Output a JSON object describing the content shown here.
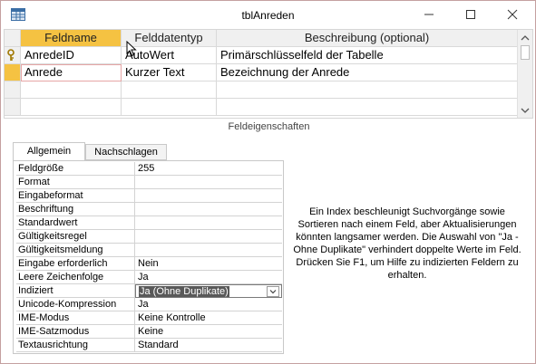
{
  "window": {
    "title": "tblAnreden"
  },
  "colors": {
    "selected_header": "#f5c242",
    "focused_value_bg": "#595959"
  },
  "grid": {
    "headers": [
      "Feldname",
      "Felddatentyp",
      "Beschreibung (optional)"
    ],
    "rows": [
      {
        "feldname": "AnredeID",
        "datentyp": "AutoWert",
        "beschreibung": "Primärschlüsselfeld der Tabelle",
        "primary_key": true
      },
      {
        "feldname": "Anrede",
        "datentyp": "Kurzer Text",
        "beschreibung": "Bezeichnung der Anrede",
        "primary_key": false
      }
    ]
  },
  "section_label": "Feldeigenschaften",
  "tabs": [
    "Allgemein",
    "Nachschlagen"
  ],
  "properties": [
    {
      "name": "Feldgröße",
      "value": "255"
    },
    {
      "name": "Format",
      "value": ""
    },
    {
      "name": "Eingabeformat",
      "value": ""
    },
    {
      "name": "Beschriftung",
      "value": ""
    },
    {
      "name": "Standardwert",
      "value": ""
    },
    {
      "name": "Gültigkeitsregel",
      "value": ""
    },
    {
      "name": "Gültigkeitsmeldung",
      "value": ""
    },
    {
      "name": "Eingabe erforderlich",
      "value": "Nein"
    },
    {
      "name": "Leere Zeichenfolge",
      "value": "Ja"
    },
    {
      "name": "Indiziert",
      "value": "Ja (Ohne Duplikate)"
    },
    {
      "name": "Unicode-Kompression",
      "value": "Ja"
    },
    {
      "name": "IME-Modus",
      "value": "Keine Kontrolle"
    },
    {
      "name": "IME-Satzmodus",
      "value": "Keine"
    },
    {
      "name": "Textausrichtung",
      "value": "Standard"
    }
  ],
  "help_text": "Ein Index beschleunigt Suchvorgänge sowie Sortieren nach einem Feld, aber Aktualisierungen könnten langsamer werden. Die Auswahl von \"Ja - Ohne Duplikate\" verhindert doppelte Werte im Feld. Drücken Sie F1, um Hilfe zu indizierten Feldern zu erhalten."
}
